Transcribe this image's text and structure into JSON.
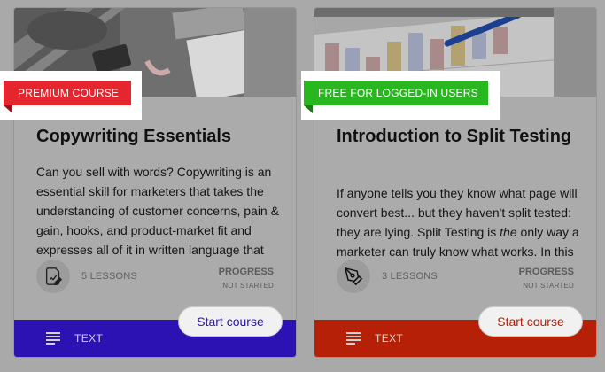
{
  "courses": [
    {
      "badge": "PREMIUM COURSE",
      "title": "Copywriting Essentials",
      "description": "Can you sell with words? Copywriting is an essential skill for marketers that takes the understanding of customer concerns, pain & gain, hooks, and product-market fit and expresses all of it in written language that",
      "lessons": "5 LESSONS",
      "progress_label": "PROGRESS",
      "progress_status": "NOT STARTED",
      "button_label": "Start course",
      "format_label": "TEXT",
      "type_icon": "document-edit-icon",
      "accent": "#2c12b3",
      "badge_color": "#e6262e"
    },
    {
      "badge": "FREE FOR LOGGED-IN USERS",
      "title": "Introduction to Split Testing",
      "description_parts": {
        "before": "If anyone tells you they know what page will convert best... but they haven't split tested: they are lying. Split Testing is ",
        "emphasis": "the",
        "after": " only way a marketer can truly know what works. In this"
      },
      "lessons": "3 LESSONS",
      "progress_label": "PROGRESS",
      "progress_status": "NOT STARTED",
      "button_label": "Start course",
      "format_label": "TEXT",
      "type_icon": "pen-nib-icon",
      "accent": "#b52007",
      "badge_color": "#29b71f"
    }
  ]
}
